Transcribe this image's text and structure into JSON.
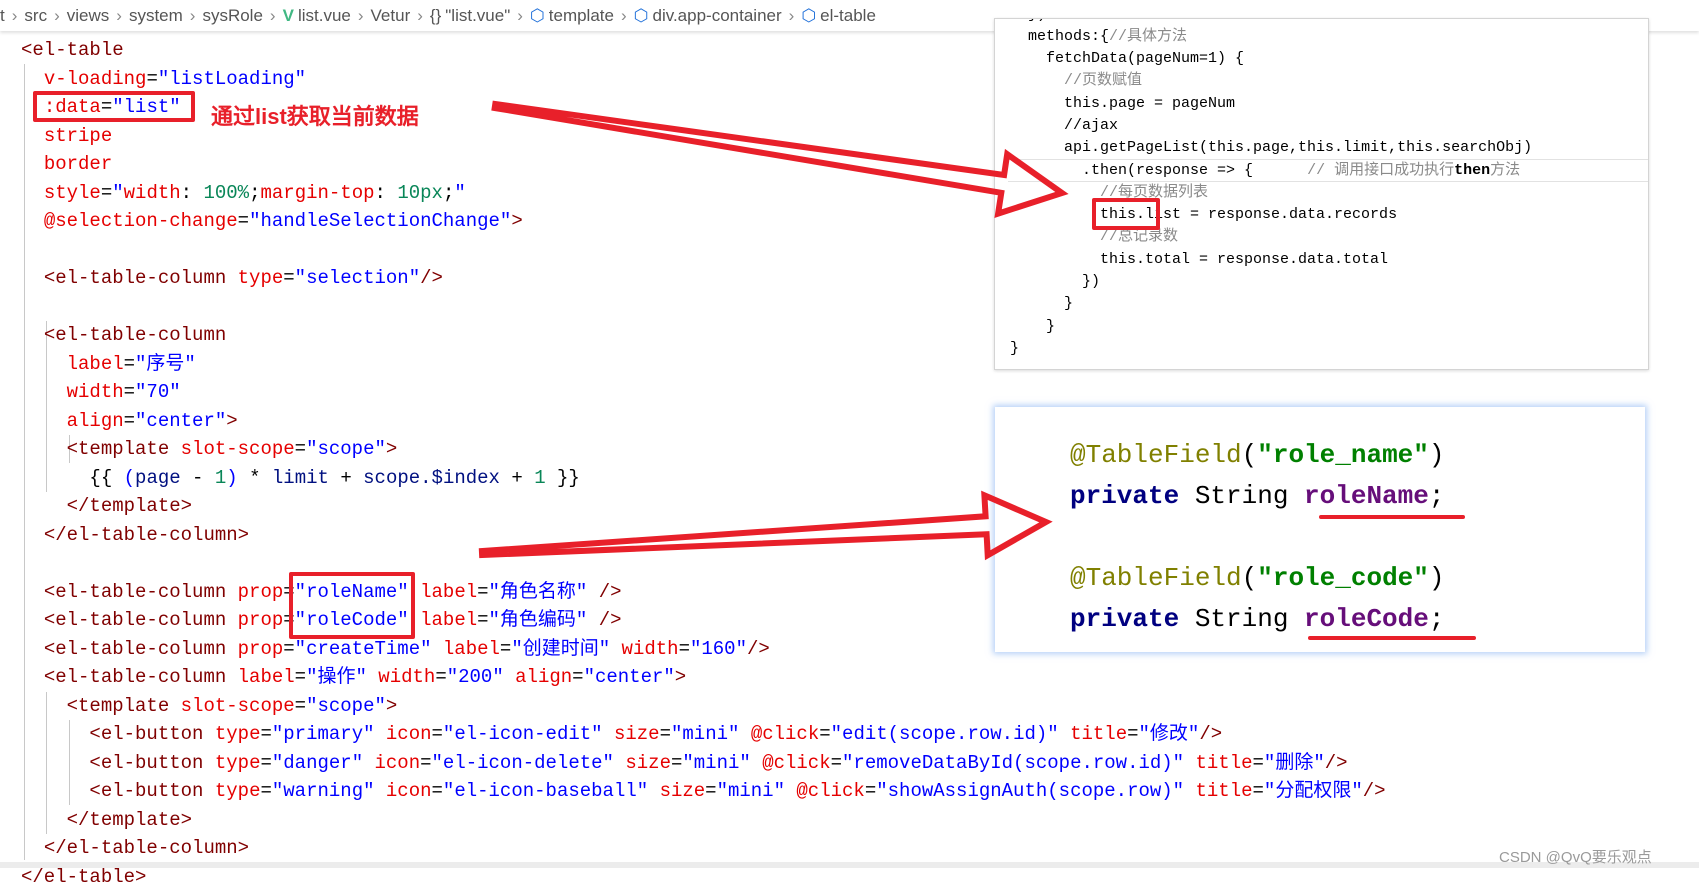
{
  "breadcrumb": [
    {
      "label": "t",
      "icon": ""
    },
    {
      "label": "src",
      "icon": ""
    },
    {
      "label": "views",
      "icon": ""
    },
    {
      "label": "system",
      "icon": ""
    },
    {
      "label": "sysRole",
      "icon": ""
    },
    {
      "label": "list.vue",
      "icon": "vue-icon"
    },
    {
      "label": "Vetur",
      "icon": ""
    },
    {
      "label": "\"list.vue\"",
      "icon": "braces-icon"
    },
    {
      "label": "template",
      "icon": "cube-icon"
    },
    {
      "label": "div.app-container",
      "icon": "cube-icon"
    },
    {
      "label": "el-table",
      "icon": "cube-icon"
    }
  ],
  "left_code": {
    "lines": [
      {
        "d": 0,
        "tk": [
          [
            "t",
            "<el-table"
          ]
        ]
      },
      {
        "d": 1,
        "tk": [
          [
            "a",
            "v-loading"
          ],
          [
            "p",
            "="
          ],
          [
            "s",
            "\"listLoading\""
          ]
        ]
      },
      {
        "d": 1,
        "tk": [
          [
            "a",
            ":data"
          ],
          [
            "p",
            "="
          ],
          [
            "s",
            "\"list\""
          ]
        ]
      },
      {
        "d": 1,
        "tk": [
          [
            "a",
            "stripe"
          ]
        ]
      },
      {
        "d": 1,
        "tk": [
          [
            "a",
            "border"
          ]
        ]
      },
      {
        "d": 1,
        "tk": [
          [
            "a",
            "style"
          ],
          [
            "p",
            "="
          ],
          [
            "s",
            "\""
          ],
          [
            "a",
            "width"
          ],
          [
            "p",
            ": "
          ],
          [
            "n",
            "100%"
          ],
          [
            "p",
            ";"
          ],
          [
            "a",
            "margin-top"
          ],
          [
            "p",
            ": "
          ],
          [
            "n",
            "10px"
          ],
          [
            "p",
            ";"
          ],
          [
            "s",
            "\""
          ]
        ]
      },
      {
        "d": 1,
        "tk": [
          [
            "a",
            "@selection-change"
          ],
          [
            "p",
            "="
          ],
          [
            "s",
            "\"handleSelectionChange\""
          ],
          [
            "t",
            ">"
          ]
        ]
      },
      {
        "d": 0,
        "tk": []
      },
      {
        "d": 1,
        "tk": [
          [
            "t",
            "<el-table-column"
          ],
          [
            "p",
            " "
          ],
          [
            "a",
            "type"
          ],
          [
            "p",
            "="
          ],
          [
            "s",
            "\"selection\""
          ],
          [
            "t",
            "/>"
          ]
        ]
      },
      {
        "d": 0,
        "tk": []
      },
      {
        "d": 1,
        "tk": [
          [
            "t",
            "<el-table-column"
          ]
        ]
      },
      {
        "d": 2,
        "tk": [
          [
            "a",
            "label"
          ],
          [
            "p",
            "="
          ],
          [
            "s",
            "\"序号\""
          ]
        ]
      },
      {
        "d": 2,
        "tk": [
          [
            "a",
            "width"
          ],
          [
            "p",
            "="
          ],
          [
            "s",
            "\"70\""
          ]
        ]
      },
      {
        "d": 2,
        "tk": [
          [
            "a",
            "align"
          ],
          [
            "p",
            "="
          ],
          [
            "s",
            "\"center\""
          ],
          [
            "t",
            ">"
          ]
        ]
      },
      {
        "d": 2,
        "tk": [
          [
            "t",
            "<template"
          ],
          [
            "p",
            " "
          ],
          [
            "a",
            "slot-scope"
          ],
          [
            "p",
            "="
          ],
          [
            "s",
            "\"scope\""
          ],
          [
            "t",
            ">"
          ]
        ]
      },
      {
        "d": 3,
        "tk": [
          [
            "p",
            "{{ "
          ],
          [
            "s",
            "("
          ],
          [
            "v",
            "page"
          ],
          [
            "p",
            " - "
          ],
          [
            "n",
            "1"
          ],
          [
            "s",
            ")"
          ],
          [
            "p",
            " * "
          ],
          [
            "v",
            "limit"
          ],
          [
            "p",
            " + "
          ],
          [
            "v",
            "scope.$index"
          ],
          [
            "p",
            " + "
          ],
          [
            "n",
            "1"
          ],
          [
            "p",
            " }}"
          ]
        ]
      },
      {
        "d": 2,
        "tk": [
          [
            "t",
            "</template>"
          ]
        ]
      },
      {
        "d": 1,
        "tk": [
          [
            "t",
            "</el-table-column>"
          ]
        ]
      },
      {
        "d": 0,
        "tk": []
      },
      {
        "d": 1,
        "tk": [
          [
            "t",
            "<el-table-column"
          ],
          [
            "p",
            " "
          ],
          [
            "a",
            "prop"
          ],
          [
            "p",
            "="
          ],
          [
            "s",
            "\"roleName\""
          ],
          [
            "p",
            " "
          ],
          [
            "a",
            "label"
          ],
          [
            "p",
            "="
          ],
          [
            "s",
            "\"角色名称\""
          ],
          [
            "p",
            " "
          ],
          [
            "t",
            "/>"
          ]
        ]
      },
      {
        "d": 1,
        "tk": [
          [
            "t",
            "<el-table-column"
          ],
          [
            "p",
            " "
          ],
          [
            "a",
            "prop"
          ],
          [
            "p",
            "="
          ],
          [
            "s",
            "\"roleCode\""
          ],
          [
            "p",
            " "
          ],
          [
            "a",
            "label"
          ],
          [
            "p",
            "="
          ],
          [
            "s",
            "\"角色编码\""
          ],
          [
            "p",
            " "
          ],
          [
            "t",
            "/>"
          ]
        ]
      },
      {
        "d": 1,
        "tk": [
          [
            "t",
            "<el-table-column"
          ],
          [
            "p",
            " "
          ],
          [
            "a",
            "prop"
          ],
          [
            "p",
            "="
          ],
          [
            "s",
            "\"createTime\""
          ],
          [
            "p",
            " "
          ],
          [
            "a",
            "label"
          ],
          [
            "p",
            "="
          ],
          [
            "s",
            "\"创建时间\""
          ],
          [
            "p",
            " "
          ],
          [
            "a",
            "width"
          ],
          [
            "p",
            "="
          ],
          [
            "s",
            "\"160\""
          ],
          [
            "t",
            "/>"
          ]
        ]
      },
      {
        "d": 1,
        "tk": [
          [
            "t",
            "<el-table-column"
          ],
          [
            "p",
            " "
          ],
          [
            "a",
            "label"
          ],
          [
            "p",
            "="
          ],
          [
            "s",
            "\"操作\""
          ],
          [
            "p",
            " "
          ],
          [
            "a",
            "width"
          ],
          [
            "p",
            "="
          ],
          [
            "s",
            "\"200\""
          ],
          [
            "p",
            " "
          ],
          [
            "a",
            "align"
          ],
          [
            "p",
            "="
          ],
          [
            "s",
            "\"center\""
          ],
          [
            "t",
            ">"
          ]
        ]
      },
      {
        "d": 2,
        "tk": [
          [
            "t",
            "<template"
          ],
          [
            "p",
            " "
          ],
          [
            "a",
            "slot-scope"
          ],
          [
            "p",
            "="
          ],
          [
            "s",
            "\"scope\""
          ],
          [
            "t",
            ">"
          ]
        ]
      },
      {
        "d": 3,
        "tk": [
          [
            "t",
            "<el-button"
          ],
          [
            "p",
            " "
          ],
          [
            "a",
            "type"
          ],
          [
            "p",
            "="
          ],
          [
            "s",
            "\"primary\""
          ],
          [
            "p",
            " "
          ],
          [
            "a",
            "icon"
          ],
          [
            "p",
            "="
          ],
          [
            "s",
            "\"el-icon-edit\""
          ],
          [
            "p",
            " "
          ],
          [
            "a",
            "size"
          ],
          [
            "p",
            "="
          ],
          [
            "s",
            "\"mini\""
          ],
          [
            "p",
            " "
          ],
          [
            "a",
            "@click"
          ],
          [
            "p",
            "="
          ],
          [
            "s",
            "\"edit(scope.row.id)\""
          ],
          [
            "p",
            " "
          ],
          [
            "a",
            "title"
          ],
          [
            "p",
            "="
          ],
          [
            "s",
            "\"修改\""
          ],
          [
            "t",
            "/>"
          ]
        ]
      },
      {
        "d": 3,
        "tk": [
          [
            "t",
            "<el-button"
          ],
          [
            "p",
            " "
          ],
          [
            "a",
            "type"
          ],
          [
            "p",
            "="
          ],
          [
            "s",
            "\"danger\""
          ],
          [
            "p",
            " "
          ],
          [
            "a",
            "icon"
          ],
          [
            "p",
            "="
          ],
          [
            "s",
            "\"el-icon-delete\""
          ],
          [
            "p",
            " "
          ],
          [
            "a",
            "size"
          ],
          [
            "p",
            "="
          ],
          [
            "s",
            "\"mini\""
          ],
          [
            "p",
            " "
          ],
          [
            "a",
            "@click"
          ],
          [
            "p",
            "="
          ],
          [
            "s",
            "\"removeDataById(scope.row.id)\""
          ],
          [
            "p",
            " "
          ],
          [
            "a",
            "title"
          ],
          [
            "p",
            "="
          ],
          [
            "s",
            "\"删除\""
          ],
          [
            "t",
            "/>"
          ]
        ]
      },
      {
        "d": 3,
        "tk": [
          [
            "t",
            "<el-button"
          ],
          [
            "p",
            " "
          ],
          [
            "a",
            "type"
          ],
          [
            "p",
            "="
          ],
          [
            "s",
            "\"warning\""
          ],
          [
            "p",
            " "
          ],
          [
            "a",
            "icon"
          ],
          [
            "p",
            "="
          ],
          [
            "s",
            "\"el-icon-baseball\""
          ],
          [
            "p",
            " "
          ],
          [
            "a",
            "size"
          ],
          [
            "p",
            "="
          ],
          [
            "s",
            "\"mini\""
          ],
          [
            "p",
            " "
          ],
          [
            "a",
            "@click"
          ],
          [
            "p",
            "="
          ],
          [
            "s",
            "\"showAssignAuth(scope.row)\""
          ],
          [
            "p",
            " "
          ],
          [
            "a",
            "title"
          ],
          [
            "p",
            "="
          ],
          [
            "s",
            "\"分配权限\""
          ],
          [
            "t",
            "/>"
          ]
        ]
      },
      {
        "d": 2,
        "tk": [
          [
            "t",
            "</template>"
          ]
        ]
      },
      {
        "d": 1,
        "tk": [
          [
            "t",
            "</el-table-column>"
          ]
        ]
      },
      {
        "d": 0,
        "tk": [
          [
            "t",
            "</el-table>"
          ]
        ]
      }
    ]
  },
  "annotation": {
    "note": "通过list获取当前数据",
    "accent": "#e8202a"
  },
  "js_panel": {
    "lines": [
      {
        "d": 1,
        "tk": [
          [
            "p",
            "})"
          ]
        ]
      },
      {
        "d": 1,
        "tk": [
          [
            "p",
            "methods:{"
          ],
          [
            "c",
            "//具体方法"
          ]
        ]
      },
      {
        "d": 2,
        "tk": [
          [
            "p",
            "fetchData(pageNum=1) {"
          ]
        ]
      },
      {
        "d": 3,
        "tk": [
          [
            "c",
            "//页数赋值"
          ]
        ]
      },
      {
        "d": 3,
        "tk": [
          [
            "p",
            "this.page = pageNum"
          ]
        ]
      },
      {
        "d": 3,
        "tk": [
          [
            "p",
            "//ajax"
          ]
        ]
      },
      {
        "d": 3,
        "tk": [
          [
            "p",
            "api.getPageList(this.page,this.limit,this.searchObj)"
          ]
        ]
      },
      {
        "d": 4,
        "tk": [
          [
            "p",
            ".then(response => {      "
          ],
          [
            "c",
            "// 调用接口成功执行"
          ],
          [
            "b",
            "then"
          ],
          [
            "c",
            "方法"
          ]
        ]
      },
      {
        "d": 5,
        "tk": [
          [
            "c",
            "//每页数据列表"
          ]
        ]
      },
      {
        "d": 5,
        "tk": [
          [
            "p",
            "this.list = response.data.records"
          ]
        ]
      },
      {
        "d": 5,
        "tk": [
          [
            "c",
            "//总记录数"
          ]
        ]
      },
      {
        "d": 5,
        "tk": [
          [
            "p",
            "this.total = response.data.total"
          ]
        ]
      },
      {
        "d": 4,
        "tk": [
          [
            "p",
            "})"
          ]
        ]
      },
      {
        "d": 3,
        "tk": [
          [
            "p",
            "}"
          ]
        ]
      },
      {
        "d": 2,
        "tk": [
          [
            "p",
            "}"
          ]
        ]
      },
      {
        "d": 0,
        "tk": [
          [
            "p",
            "}"
          ]
        ]
      }
    ]
  },
  "java_panel": {
    "lines": [
      [
        [
          "ann",
          "@TableField"
        ],
        [
          "p",
          "("
        ],
        [
          "jstr",
          "\"role_name\""
        ],
        [
          "p",
          ")"
        ]
      ],
      [
        [
          "kw",
          "private"
        ],
        [
          "p",
          " String "
        ],
        [
          "fld",
          "roleName"
        ],
        [
          "p",
          ";"
        ]
      ],
      [],
      [
        [
          "ann",
          "@TableField"
        ],
        [
          "p",
          "("
        ],
        [
          "jstr",
          "\"role_code\""
        ],
        [
          "p",
          ")"
        ]
      ],
      [
        [
          "kw",
          "private"
        ],
        [
          "p",
          " String "
        ],
        [
          "fld",
          "roleCode"
        ],
        [
          "p",
          ";"
        ]
      ]
    ]
  },
  "watermark": "CSDN @QvQ要乐观点"
}
